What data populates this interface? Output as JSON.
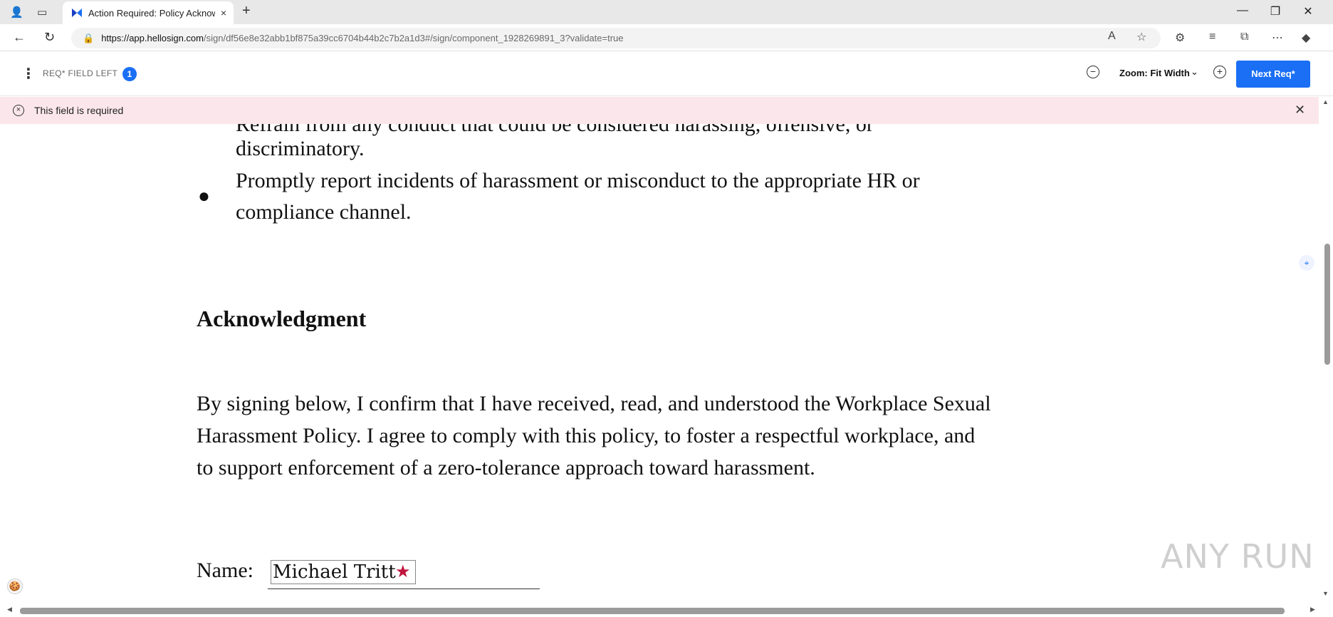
{
  "browser": {
    "tab_title": "Action Required: Policy Acknowle",
    "url_host": "https://app.hellosign.com",
    "url_path": "/sign/df56e8e32abb1bf875a39cc6704b44b2c7b2a1d3#/sign/component_1928269891_3?validate=true",
    "new_tab": "+",
    "close_tab": "×"
  },
  "toolbar": {
    "req_label": "REQ* FIELD LEFT",
    "req_count": "1",
    "zoom_label": "Zoom: Fit Width",
    "next_label": "Next Req*"
  },
  "error": {
    "message": "This field is required"
  },
  "document": {
    "cut_line": "Refrain from any conduct that could be considered harassing, offensive, or",
    "line1": "discriminatory.",
    "bullet_line1": "Promptly report incidents of harassment or misconduct to the appropriate HR or",
    "bullet_line2": "compliance channel.",
    "heading": "Acknowledgment",
    "para_line1": "By signing below, I confirm that I have received, read, and understood the Workplace Sexual",
    "para_line2": "Harassment Policy. I agree to comply with this policy, to foster a respectful workplace, and",
    "para_line3": "to support enforcement of a zero-tolerance approach toward harassment.",
    "name_label": "Name:",
    "name_value": "Michael Tritt"
  },
  "watermark": "ANY RUN",
  "colors": {
    "accent": "#1a6ff5",
    "error_bg": "#fbe7eb",
    "required_star": "#c0143c"
  }
}
